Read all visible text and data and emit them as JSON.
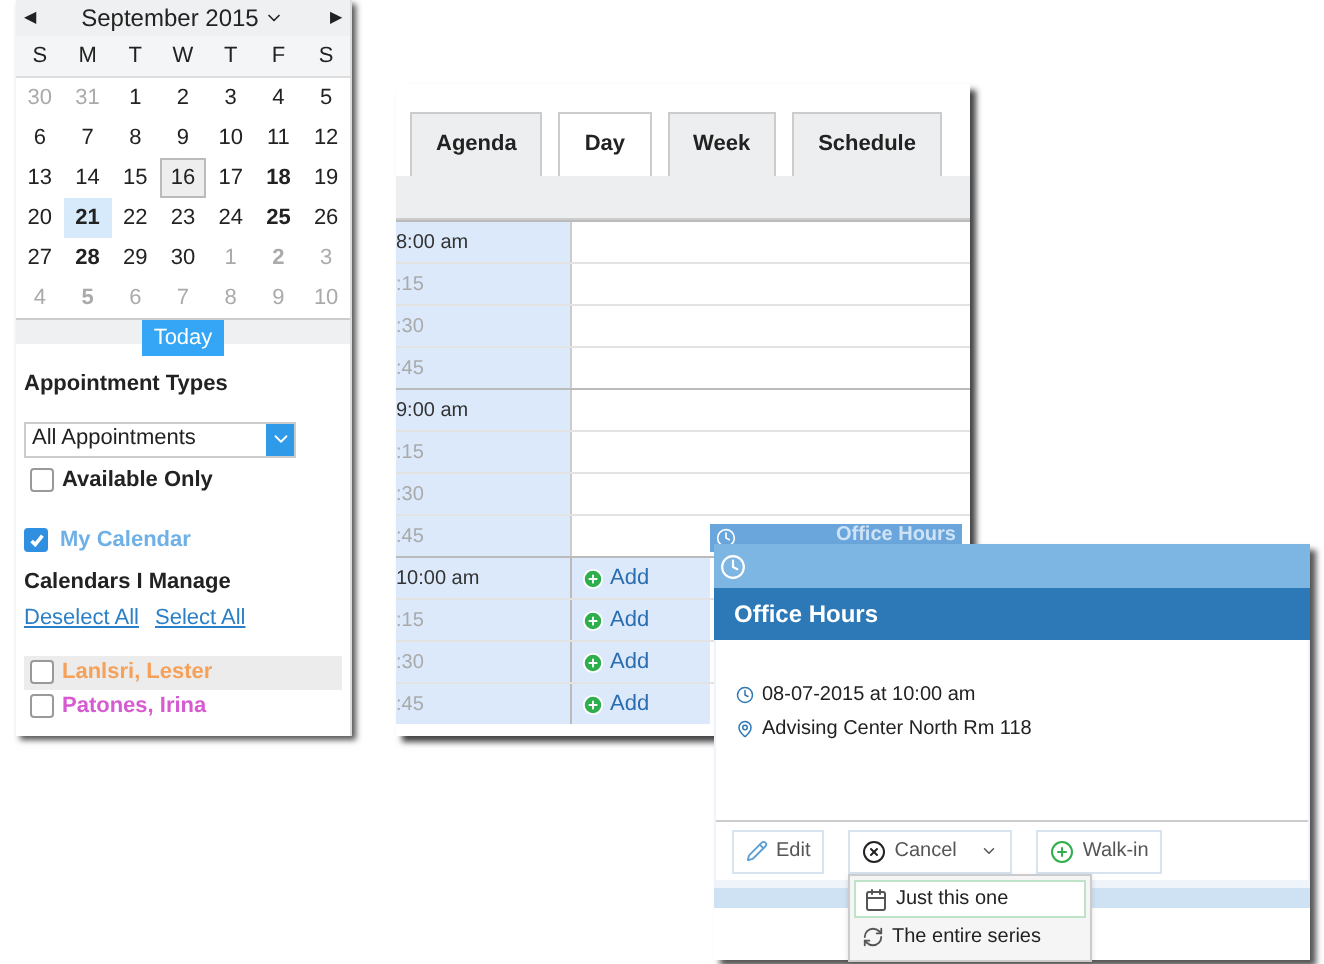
{
  "mini_calendar": {
    "month": "September 2015",
    "prev": "◀",
    "next": "▶",
    "weekdays": [
      "S",
      "M",
      "T",
      "W",
      "T",
      "F",
      "S"
    ],
    "weeks": [
      [
        {
          "day": "30",
          "other_month": true,
          "bold": false,
          "selected": false,
          "today": false
        },
        {
          "day": "31",
          "other_month": true,
          "bold": false,
          "selected": false,
          "today": false
        },
        {
          "day": "1",
          "other_month": false,
          "bold": false,
          "selected": false,
          "today": false
        },
        {
          "day": "2",
          "other_month": false,
          "bold": false,
          "selected": false,
          "today": false
        },
        {
          "day": "3",
          "other_month": false,
          "bold": false,
          "selected": false,
          "today": false
        },
        {
          "day": "4",
          "other_month": false,
          "bold": false,
          "selected": false,
          "today": false
        },
        {
          "day": "5",
          "other_month": false,
          "bold": false,
          "selected": false,
          "today": false
        }
      ],
      [
        {
          "day": "6",
          "other_month": false,
          "bold": false,
          "selected": false,
          "today": false
        },
        {
          "day": "7",
          "other_month": false,
          "bold": false,
          "selected": false,
          "today": false
        },
        {
          "day": "8",
          "other_month": false,
          "bold": false,
          "selected": false,
          "today": false
        },
        {
          "day": "9",
          "other_month": false,
          "bold": false,
          "selected": false,
          "today": false
        },
        {
          "day": "10",
          "other_month": false,
          "bold": false,
          "selected": false,
          "today": false
        },
        {
          "day": "11",
          "other_month": false,
          "bold": false,
          "selected": false,
          "today": false
        },
        {
          "day": "12",
          "other_month": false,
          "bold": false,
          "selected": false,
          "today": false
        }
      ],
      [
        {
          "day": "13",
          "other_month": false,
          "bold": false,
          "selected": false,
          "today": false
        },
        {
          "day": "14",
          "other_month": false,
          "bold": false,
          "selected": false,
          "today": false
        },
        {
          "day": "15",
          "other_month": false,
          "bold": false,
          "selected": false,
          "today": false
        },
        {
          "day": "16",
          "other_month": false,
          "bold": false,
          "selected": false,
          "today": true
        },
        {
          "day": "17",
          "other_month": false,
          "bold": false,
          "selected": false,
          "today": false
        },
        {
          "day": "18",
          "other_month": false,
          "bold": true,
          "selected": false,
          "today": false
        },
        {
          "day": "19",
          "other_month": false,
          "bold": false,
          "selected": false,
          "today": false
        }
      ],
      [
        {
          "day": "20",
          "other_month": false,
          "bold": false,
          "selected": false,
          "today": false
        },
        {
          "day": "21",
          "other_month": false,
          "bold": true,
          "selected": true,
          "today": false
        },
        {
          "day": "22",
          "other_month": false,
          "bold": false,
          "selected": false,
          "today": false
        },
        {
          "day": "23",
          "other_month": false,
          "bold": false,
          "selected": false,
          "today": false
        },
        {
          "day": "24",
          "other_month": false,
          "bold": false,
          "selected": false,
          "today": false
        },
        {
          "day": "25",
          "other_month": false,
          "bold": true,
          "selected": false,
          "today": false
        },
        {
          "day": "26",
          "other_month": false,
          "bold": false,
          "selected": false,
          "today": false
        }
      ],
      [
        {
          "day": "27",
          "other_month": false,
          "bold": false,
          "selected": false,
          "today": false
        },
        {
          "day": "28",
          "other_month": false,
          "bold": true,
          "selected": false,
          "today": false
        },
        {
          "day": "29",
          "other_month": false,
          "bold": false,
          "selected": false,
          "today": false
        },
        {
          "day": "30",
          "other_month": false,
          "bold": false,
          "selected": false,
          "today": false
        },
        {
          "day": "1",
          "other_month": true,
          "bold": false,
          "selected": false,
          "today": false
        },
        {
          "day": "2",
          "other_month": true,
          "bold": true,
          "selected": false,
          "today": false
        },
        {
          "day": "3",
          "other_month": true,
          "bold": false,
          "selected": false,
          "today": false
        }
      ],
      [
        {
          "day": "4",
          "other_month": true,
          "bold": false,
          "selected": false,
          "today": false
        },
        {
          "day": "5",
          "other_month": true,
          "bold": true,
          "selected": false,
          "today": false
        },
        {
          "day": "6",
          "other_month": true,
          "bold": false,
          "selected": false,
          "today": false
        },
        {
          "day": "7",
          "other_month": true,
          "bold": false,
          "selected": false,
          "today": false
        },
        {
          "day": "8",
          "other_month": true,
          "bold": false,
          "selected": false,
          "today": false
        },
        {
          "day": "9",
          "other_month": true,
          "bold": false,
          "selected": false,
          "today": false
        },
        {
          "day": "10",
          "other_month": true,
          "bold": false,
          "selected": false,
          "today": false
        }
      ]
    ],
    "today_button": "Today"
  },
  "filters": {
    "appointment_types_label": "Appointment Types",
    "appointment_types_value": "All Appointments",
    "available_only": {
      "label": "Available Only",
      "checked": false
    },
    "my_calendar": {
      "label": "My Calendar",
      "checked": true
    },
    "calendars_label": "Calendars I Manage",
    "deselect_all": "Deselect All",
    "select_all": "Select All",
    "calendars": [
      {
        "name": "Lanlsri, Lester",
        "color": "#f5a15a",
        "checked": false,
        "selected": true
      },
      {
        "name": "Patones, Irina",
        "color": "#d65ad0",
        "checked": false,
        "selected": false
      }
    ]
  },
  "tabs": [
    {
      "label": "Agenda",
      "selected": false
    },
    {
      "label": "Day",
      "selected": true
    },
    {
      "label": "Week",
      "selected": false
    },
    {
      "label": "Schedule",
      "selected": false
    }
  ],
  "time_slots": [
    {
      "time": "8:00 am",
      "hour": true
    },
    {
      "time": ":15",
      "hour": false
    },
    {
      "time": ":30",
      "hour": false
    },
    {
      "time": ":45",
      "hour": false
    },
    {
      "time": "9:00 am",
      "hour": true
    },
    {
      "time": ":15",
      "hour": false
    },
    {
      "time": ":30",
      "hour": false
    },
    {
      "time": ":45",
      "hour": false
    },
    {
      "time": "10:00 am",
      "hour": true,
      "add": "Add"
    },
    {
      "time": ":15",
      "hour": false,
      "add": "Add"
    },
    {
      "time": ":30",
      "hour": false,
      "add": "Add"
    },
    {
      "time": ":45",
      "hour": false,
      "add": "Add"
    }
  ],
  "back_popup": {
    "title": "Office Hours"
  },
  "popup": {
    "title": "Office Hours",
    "when": "08-07-2015 at 10:00 am",
    "where": "Advising Center North Rm 118",
    "buttons": [
      {
        "label": "Edit",
        "kind": "edit"
      },
      {
        "label": "Cancel",
        "kind": "cancel"
      },
      {
        "label": "Walk-in",
        "kind": "walkin"
      }
    ],
    "cancel_menu": [
      {
        "label": "Just this one",
        "kind": "single",
        "selected": true
      },
      {
        "label": "The entire series",
        "kind": "series",
        "selected": false
      }
    ]
  }
}
